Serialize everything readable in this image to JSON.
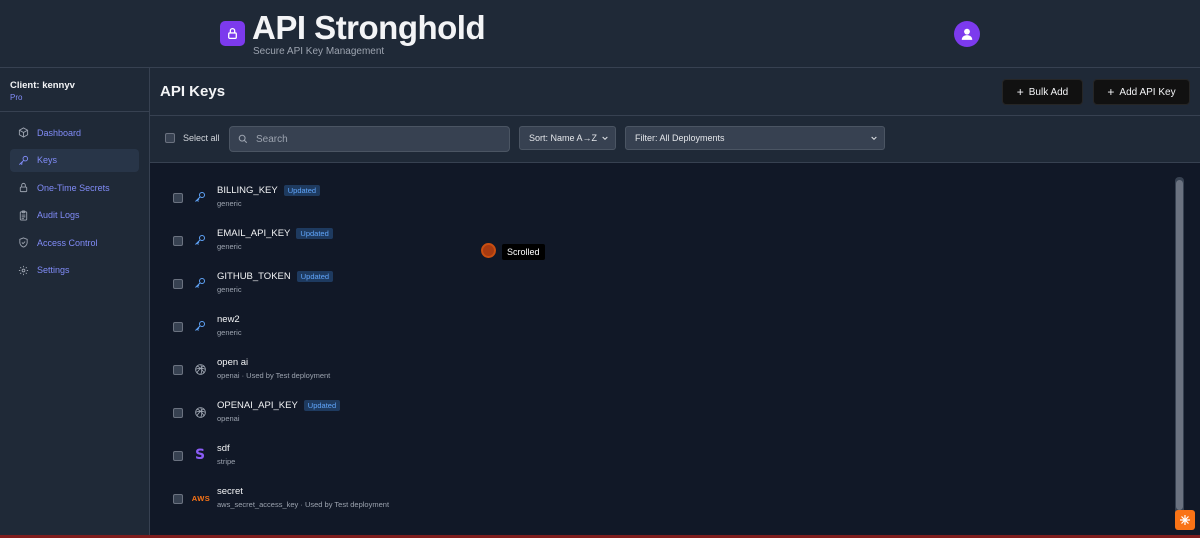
{
  "header": {
    "title": "API Stronghold",
    "subtitle": "Secure API Key Management",
    "logo_icon": "lock-icon",
    "avatar_icon": "user-icon",
    "accent_color": "#7c3aed"
  },
  "sidebar": {
    "client_label": "Client: kennyv",
    "plan": "Pro",
    "items": [
      {
        "label": "Dashboard",
        "icon": "cube-icon"
      },
      {
        "label": "Keys",
        "icon": "key-icon",
        "active": true
      },
      {
        "label": "One-Time Secrets",
        "icon": "lock-icon"
      },
      {
        "label": "Audit Logs",
        "icon": "clipboard-icon"
      },
      {
        "label": "Access Control",
        "icon": "shield-icon"
      },
      {
        "label": "Settings",
        "icon": "gear-icon"
      }
    ]
  },
  "main": {
    "title": "API Keys",
    "bulk_add_label": "Bulk Add",
    "add_key_label": "Add API Key",
    "select_all_label": "Select all",
    "search_placeholder": "Search",
    "sort_value": "Sort: Name A→Z",
    "filter_value": "Filter: All Deployments"
  },
  "keys": [
    {
      "name": "BILLING_KEY",
      "badge": "Updated",
      "sub": "generic",
      "icon": "key-icon"
    },
    {
      "name": "EMAIL_API_KEY",
      "badge": "Updated",
      "sub": "generic",
      "icon": "key-icon"
    },
    {
      "name": "GITHUB_TOKEN",
      "badge": "Updated",
      "sub": "generic",
      "icon": "key-icon"
    },
    {
      "name": "new2",
      "badge": "",
      "sub": "generic",
      "icon": "key-icon"
    },
    {
      "name": "open ai",
      "badge": "",
      "sub": "openai · Used by Test deployment",
      "icon": "openai-icon"
    },
    {
      "name": "OPENAI_API_KEY",
      "badge": "Updated",
      "sub": "openai",
      "icon": "openai-icon"
    },
    {
      "name": "sdf",
      "badge": "",
      "sub": "stripe",
      "icon": "stripe-icon"
    },
    {
      "name": "secret",
      "badge": "",
      "sub": "aws_secret_access_key · Used by Test deployment",
      "icon": "aws-icon",
      "icon_text": "AWS"
    }
  ],
  "tooltip": "Scrolled"
}
